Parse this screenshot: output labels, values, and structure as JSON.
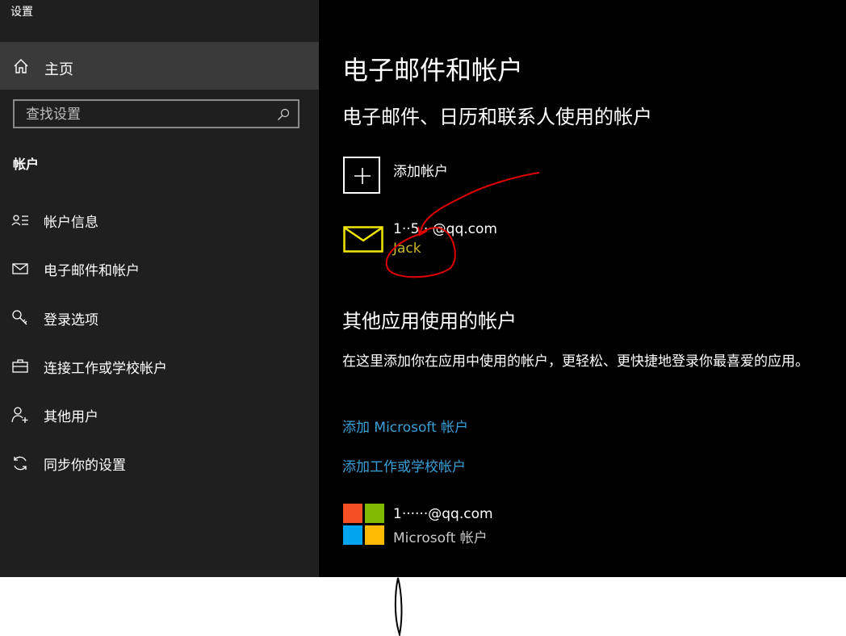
{
  "window": {
    "title": "设置"
  },
  "sidebar": {
    "home_label": "主页",
    "search_placeholder": "查找设置",
    "section_title": "帐户",
    "items": [
      {
        "label": "帐户信息",
        "icon": "account-info-icon"
      },
      {
        "label": "电子邮件和帐户",
        "icon": "mail-icon"
      },
      {
        "label": "登录选项",
        "icon": "key-icon"
      },
      {
        "label": "连接工作或学校帐户",
        "icon": "briefcase-icon"
      },
      {
        "label": "其他用户",
        "icon": "person-add-icon"
      },
      {
        "label": "同步你的设置",
        "icon": "sync-icon"
      }
    ]
  },
  "main": {
    "title": "电子邮件和帐户",
    "subtitle": "电子邮件、日历和联系人使用的帐户",
    "add_account_label": "添加帐户",
    "mail_account": {
      "email": "1··5···@qq.com",
      "name": "Jack"
    },
    "section2_title": "其他应用使用的帐户",
    "section2_desc": "在这里添加你在应用中使用的帐户，更轻松、更快捷地登录你最喜爱的应用。",
    "link_add_microsoft": "添加 Microsoft 帐户",
    "link_add_work": "添加工作或学校帐户",
    "ms_account": {
      "email": "1······@qq.com",
      "type": "Microsoft 帐户"
    }
  },
  "colors": {
    "sidebar_bg": "#1f1f1f",
    "main_bg": "#000000",
    "link": "#3aa0d8",
    "annotation": "#e00000",
    "mail_icon": "#f2e600"
  }
}
